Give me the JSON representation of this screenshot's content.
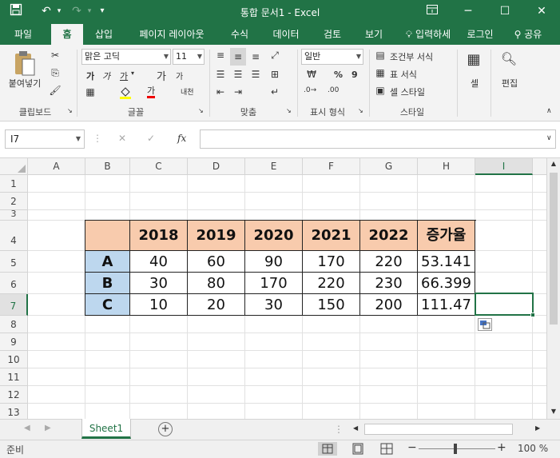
{
  "title_bar": {
    "title": "통합 문서1 - Excel",
    "accent_color": "#217346"
  },
  "tabs": [
    {
      "label": "파일"
    },
    {
      "label": "홈"
    },
    {
      "label": "삽입"
    },
    {
      "label": "페이지 레이아웃"
    },
    {
      "label": "수식"
    },
    {
      "label": "데이터"
    },
    {
      "label": "검토"
    },
    {
      "label": "보기"
    }
  ],
  "tell_me": "입력하세",
  "account": {
    "login": "로그인",
    "share": "공유"
  },
  "ribbon": {
    "clipboard": {
      "paste_label": "붙여넣기",
      "group_label": "클립보드"
    },
    "font": {
      "font_name": "맑은 고딕",
      "font_size": "11",
      "bold": "가",
      "italic": "가",
      "underline": "가",
      "grow": "가",
      "shrink": "가",
      "color_a": "가",
      "phonetic": "내천",
      "group_label": "글꼴"
    },
    "alignment": {
      "group_label": "맞춤"
    },
    "number": {
      "format": "일반",
      "percent": "%",
      "comma": "9",
      "group_label": "표시 형식"
    },
    "styles": {
      "conditional": "조건부 서식",
      "table": "표 서식",
      "cell_styles": "셀 스타일",
      "group_label": "스타일"
    },
    "cells": {
      "label": "셀"
    },
    "editing": {
      "label": "편집"
    }
  },
  "formula_bar": {
    "name_box": "I7",
    "cancel": "✕",
    "enter": "✓",
    "fx": "fx",
    "formula": ""
  },
  "grid": {
    "columns": [
      "A",
      "B",
      "C",
      "D",
      "E",
      "F",
      "G",
      "H",
      "I"
    ],
    "rows": [
      "1",
      "2",
      "3",
      "4",
      "5",
      "6",
      "7",
      "8",
      "9",
      "10",
      "11",
      "12",
      "13"
    ],
    "selected_cell": "I7",
    "header_fill": "#f8cbad",
    "row_label_fill": "#bdd7ee"
  },
  "table": {
    "headers": [
      "",
      "2018",
      "2019",
      "2020",
      "2021",
      "2022",
      "증가율"
    ],
    "rows": [
      {
        "label": "A",
        "values": [
          "40",
          "60",
          "90",
          "170",
          "220",
          "53.141"
        ]
      },
      {
        "label": "B",
        "values": [
          "30",
          "80",
          "170",
          "220",
          "230",
          "66.399"
        ]
      },
      {
        "label": "C",
        "values": [
          "10",
          "20",
          "30",
          "150",
          "200",
          "111.47"
        ]
      }
    ]
  },
  "sheet_tabs": [
    {
      "label": "Sheet1"
    }
  ],
  "status_bar": {
    "ready": "준비",
    "zoom": "100 %"
  }
}
